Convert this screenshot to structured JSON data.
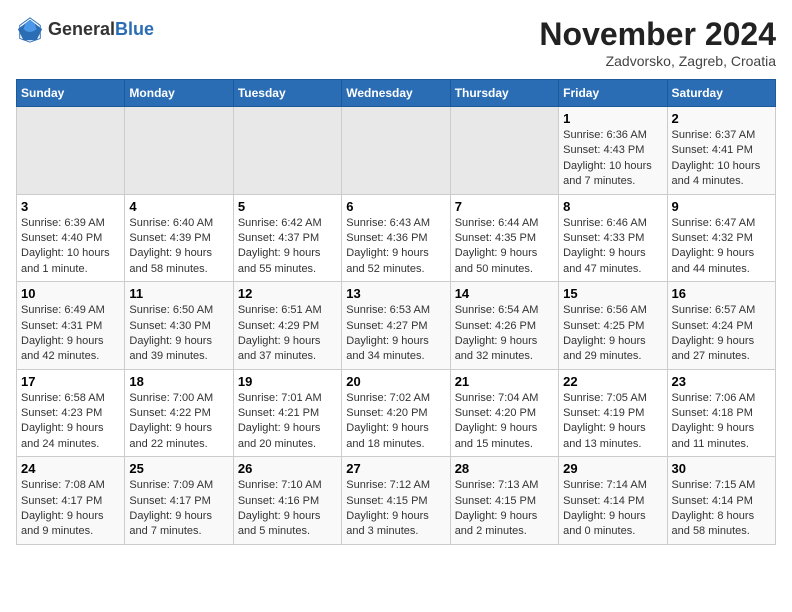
{
  "logo": {
    "text_general": "General",
    "text_blue": "Blue"
  },
  "header": {
    "month": "November 2024",
    "location": "Zadvorsko, Zagreb, Croatia"
  },
  "weekdays": [
    "Sunday",
    "Monday",
    "Tuesday",
    "Wednesday",
    "Thursday",
    "Friday",
    "Saturday"
  ],
  "weeks": [
    [
      {
        "day": "",
        "empty": true
      },
      {
        "day": "",
        "empty": true
      },
      {
        "day": "",
        "empty": true
      },
      {
        "day": "",
        "empty": true
      },
      {
        "day": "",
        "empty": true
      },
      {
        "day": "1",
        "sunrise": "Sunrise: 6:36 AM",
        "sunset": "Sunset: 4:43 PM",
        "daylight": "Daylight: 10 hours and 7 minutes."
      },
      {
        "day": "2",
        "sunrise": "Sunrise: 6:37 AM",
        "sunset": "Sunset: 4:41 PM",
        "daylight": "Daylight: 10 hours and 4 minutes."
      }
    ],
    [
      {
        "day": "3",
        "sunrise": "Sunrise: 6:39 AM",
        "sunset": "Sunset: 4:40 PM",
        "daylight": "Daylight: 10 hours and 1 minute."
      },
      {
        "day": "4",
        "sunrise": "Sunrise: 6:40 AM",
        "sunset": "Sunset: 4:39 PM",
        "daylight": "Daylight: 9 hours and 58 minutes."
      },
      {
        "day": "5",
        "sunrise": "Sunrise: 6:42 AM",
        "sunset": "Sunset: 4:37 PM",
        "daylight": "Daylight: 9 hours and 55 minutes."
      },
      {
        "day": "6",
        "sunrise": "Sunrise: 6:43 AM",
        "sunset": "Sunset: 4:36 PM",
        "daylight": "Daylight: 9 hours and 52 minutes."
      },
      {
        "day": "7",
        "sunrise": "Sunrise: 6:44 AM",
        "sunset": "Sunset: 4:35 PM",
        "daylight": "Daylight: 9 hours and 50 minutes."
      },
      {
        "day": "8",
        "sunrise": "Sunrise: 6:46 AM",
        "sunset": "Sunset: 4:33 PM",
        "daylight": "Daylight: 9 hours and 47 minutes."
      },
      {
        "day": "9",
        "sunrise": "Sunrise: 6:47 AM",
        "sunset": "Sunset: 4:32 PM",
        "daylight": "Daylight: 9 hours and 44 minutes."
      }
    ],
    [
      {
        "day": "10",
        "sunrise": "Sunrise: 6:49 AM",
        "sunset": "Sunset: 4:31 PM",
        "daylight": "Daylight: 9 hours and 42 minutes."
      },
      {
        "day": "11",
        "sunrise": "Sunrise: 6:50 AM",
        "sunset": "Sunset: 4:30 PM",
        "daylight": "Daylight: 9 hours and 39 minutes."
      },
      {
        "day": "12",
        "sunrise": "Sunrise: 6:51 AM",
        "sunset": "Sunset: 4:29 PM",
        "daylight": "Daylight: 9 hours and 37 minutes."
      },
      {
        "day": "13",
        "sunrise": "Sunrise: 6:53 AM",
        "sunset": "Sunset: 4:27 PM",
        "daylight": "Daylight: 9 hours and 34 minutes."
      },
      {
        "day": "14",
        "sunrise": "Sunrise: 6:54 AM",
        "sunset": "Sunset: 4:26 PM",
        "daylight": "Daylight: 9 hours and 32 minutes."
      },
      {
        "day": "15",
        "sunrise": "Sunrise: 6:56 AM",
        "sunset": "Sunset: 4:25 PM",
        "daylight": "Daylight: 9 hours and 29 minutes."
      },
      {
        "day": "16",
        "sunrise": "Sunrise: 6:57 AM",
        "sunset": "Sunset: 4:24 PM",
        "daylight": "Daylight: 9 hours and 27 minutes."
      }
    ],
    [
      {
        "day": "17",
        "sunrise": "Sunrise: 6:58 AM",
        "sunset": "Sunset: 4:23 PM",
        "daylight": "Daylight: 9 hours and 24 minutes."
      },
      {
        "day": "18",
        "sunrise": "Sunrise: 7:00 AM",
        "sunset": "Sunset: 4:22 PM",
        "daylight": "Daylight: 9 hours and 22 minutes."
      },
      {
        "day": "19",
        "sunrise": "Sunrise: 7:01 AM",
        "sunset": "Sunset: 4:21 PM",
        "daylight": "Daylight: 9 hours and 20 minutes."
      },
      {
        "day": "20",
        "sunrise": "Sunrise: 7:02 AM",
        "sunset": "Sunset: 4:20 PM",
        "daylight": "Daylight: 9 hours and 18 minutes."
      },
      {
        "day": "21",
        "sunrise": "Sunrise: 7:04 AM",
        "sunset": "Sunset: 4:20 PM",
        "daylight": "Daylight: 9 hours and 15 minutes."
      },
      {
        "day": "22",
        "sunrise": "Sunrise: 7:05 AM",
        "sunset": "Sunset: 4:19 PM",
        "daylight": "Daylight: 9 hours and 13 minutes."
      },
      {
        "day": "23",
        "sunrise": "Sunrise: 7:06 AM",
        "sunset": "Sunset: 4:18 PM",
        "daylight": "Daylight: 9 hours and 11 minutes."
      }
    ],
    [
      {
        "day": "24",
        "sunrise": "Sunrise: 7:08 AM",
        "sunset": "Sunset: 4:17 PM",
        "daylight": "Daylight: 9 hours and 9 minutes."
      },
      {
        "day": "25",
        "sunrise": "Sunrise: 7:09 AM",
        "sunset": "Sunset: 4:17 PM",
        "daylight": "Daylight: 9 hours and 7 minutes."
      },
      {
        "day": "26",
        "sunrise": "Sunrise: 7:10 AM",
        "sunset": "Sunset: 4:16 PM",
        "daylight": "Daylight: 9 hours and 5 minutes."
      },
      {
        "day": "27",
        "sunrise": "Sunrise: 7:12 AM",
        "sunset": "Sunset: 4:15 PM",
        "daylight": "Daylight: 9 hours and 3 minutes."
      },
      {
        "day": "28",
        "sunrise": "Sunrise: 7:13 AM",
        "sunset": "Sunset: 4:15 PM",
        "daylight": "Daylight: 9 hours and 2 minutes."
      },
      {
        "day": "29",
        "sunrise": "Sunrise: 7:14 AM",
        "sunset": "Sunset: 4:14 PM",
        "daylight": "Daylight: 9 hours and 0 minutes."
      },
      {
        "day": "30",
        "sunrise": "Sunrise: 7:15 AM",
        "sunset": "Sunset: 4:14 PM",
        "daylight": "Daylight: 8 hours and 58 minutes."
      }
    ]
  ]
}
